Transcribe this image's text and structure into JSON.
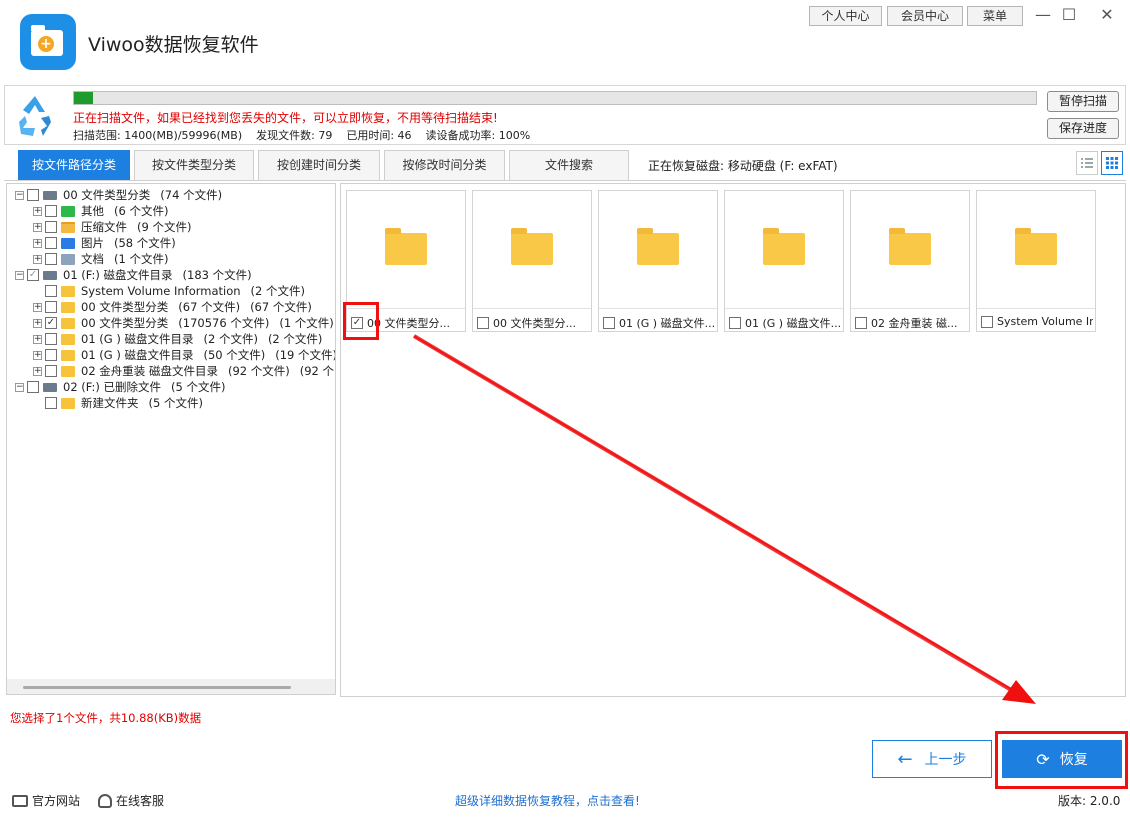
{
  "app": {
    "title": "Viwoo数据恢复软件"
  },
  "top_buttons": {
    "personal": "个人中心",
    "member": "会员中心",
    "menu": "菜单"
  },
  "scan": {
    "progress_fraction": 0.02,
    "message": "正在扫描文件，如果已经找到您丢失的文件，可以立即恢复，不用等待扫描结束!",
    "range": "扫描范围: 1400(MB)/59996(MB)",
    "found": "发现文件数: 79",
    "elapsed": "已用时间: 46",
    "read_rate": "读设备成功率: 100%",
    "pause_label": "暂停扫描",
    "save_label": "保存进度"
  },
  "tabs": [
    {
      "label": "按文件路径分类",
      "active": true
    },
    {
      "label": "按文件类型分类",
      "active": false
    },
    {
      "label": "按创建时间分类",
      "active": false
    },
    {
      "label": "按修改时间分类",
      "active": false
    },
    {
      "label": "文件搜索",
      "active": false
    }
  ],
  "disk_info": "正在恢复磁盘: 移动硬盘 (F: exFAT)",
  "tree": [
    {
      "name": "00 文件类型分类",
      "count": "(74 个文件)",
      "count2": ""
    },
    {
      "name": "其他",
      "count": "(6 个文件)",
      "count2": ""
    },
    {
      "name": "压缩文件",
      "count": "(9 个文件)",
      "count2": ""
    },
    {
      "name": "图片",
      "count": "(58 个文件)",
      "count2": ""
    },
    {
      "name": "文档",
      "count": "(1 个文件)",
      "count2": ""
    },
    {
      "name": "01 (F:) 磁盘文件目录",
      "count": "(183 个文件)",
      "count2": ""
    },
    {
      "name": "System Volume Information",
      "count": "(2 个文件)",
      "count2": ""
    },
    {
      "name": "00 文件类型分类",
      "count": "(67 个文件)",
      "count2": "(67 个文件)"
    },
    {
      "name": "00 文件类型分类",
      "count": "(170576 个文件)",
      "count2": "(1 个文件)"
    },
    {
      "name": "01 (G ) 磁盘文件目录",
      "count": "(2 个文件)",
      "count2": "(2 个文件)"
    },
    {
      "name": "01 (G ) 磁盘文件目录",
      "count": "(50 个文件)",
      "count2": "(19 个文件)"
    },
    {
      "name": "02 金舟重装 磁盘文件目录",
      "count": "(92 个文件)",
      "count2": "(92 个"
    },
    {
      "name": "02 (F:) 已删除文件",
      "count": "(5 个文件)",
      "count2": ""
    },
    {
      "name": "新建文件夹",
      "count": "(5 个文件)",
      "count2": ""
    }
  ],
  "cards": [
    {
      "label": "00 文件类型分...",
      "checked": true
    },
    {
      "label": "00 文件类型分...",
      "checked": false
    },
    {
      "label": "01 (G ) 磁盘文件...",
      "checked": false
    },
    {
      "label": "01 (G ) 磁盘文件...",
      "checked": false
    },
    {
      "label": "02 金舟重装 磁...",
      "checked": false
    },
    {
      "label": "System Volume In...",
      "checked": false
    }
  ],
  "selection_info": "您选择了1个文件，共10.88(KB)数据",
  "buttons": {
    "back": "上一步",
    "recover": "恢复"
  },
  "footer": {
    "official_site": "官方网站",
    "online_service": "在线客服",
    "tutorial": "超级详细数据恢复教程，点击查看!",
    "version": "版本: 2.0.0"
  },
  "colors": {
    "accent": "#1d7fe0",
    "alert": "#e00000",
    "highlight": "#f01010"
  }
}
